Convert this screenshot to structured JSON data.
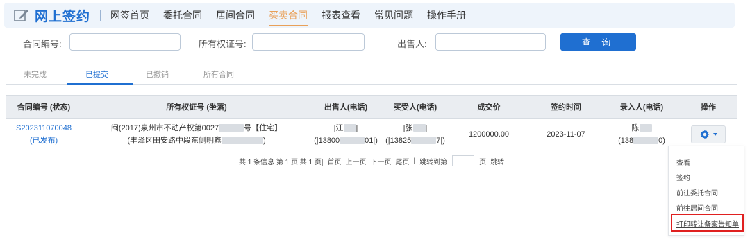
{
  "brand": {
    "title": "网上签约"
  },
  "nav": {
    "items": [
      {
        "label": "网签首页"
      },
      {
        "label": "委托合同"
      },
      {
        "label": "居间合同"
      },
      {
        "label": "买卖合同",
        "active": true
      },
      {
        "label": "报表查看"
      },
      {
        "label": "常见问题"
      },
      {
        "label": "操作手册"
      }
    ]
  },
  "search": {
    "contract_no_label": "合同编号:",
    "contract_no_value": "",
    "ownership_label": "所有权证号:",
    "ownership_value": "",
    "seller_label": "出售人:",
    "seller_value": "",
    "query_button": "查 询"
  },
  "subtabs": [
    {
      "label": "未完成"
    },
    {
      "label": "已提交",
      "active": true
    },
    {
      "label": "已撤销"
    },
    {
      "label": "所有合同"
    }
  ],
  "table": {
    "headers": [
      "合同编号 (状态)",
      "所有权证号 (坐落)",
      "出售人(电话)",
      "买受人(电话)",
      "成交价",
      "签约时间",
      "录入人(电话)",
      "操作"
    ],
    "rows": [
      {
        "contract_no": "S202311070048",
        "status": "(已发布)",
        "cert_line1_a": "闽(2017)泉州市不动产权第0027",
        "cert_line1_b": "号【住宅】",
        "cert_line2_a": "(丰泽区田安路中段东侧明鑫",
        "cert_line2_b": ")",
        "seller_name_a": "|江",
        "seller_name_b": "|",
        "seller_phone_a": "(|13800",
        "seller_phone_b": "01|)",
        "buyer_name_a": "|张",
        "buyer_name_b": "|",
        "buyer_phone_a": "(|13825",
        "buyer_phone_b": "7|)",
        "price": "1200000.00",
        "sign_date": "2023-11-07",
        "entry_name": "陈",
        "entry_phone_a": "(138",
        "entry_phone_b": "0)"
      }
    ]
  },
  "pager": {
    "summary": "共 1 条信息 第 1 页 共 1 页|",
    "first": "首页",
    "prev": "上一页",
    "next": "下一页",
    "last": "尾页",
    "divider": "|",
    "jump_to": "跳转到第",
    "page_unit": "页",
    "jump": "跳转"
  },
  "dropdown": {
    "items": [
      {
        "label": "查看"
      },
      {
        "label": "签约"
      },
      {
        "label": "前往委托合同"
      },
      {
        "label": "前往居间合同"
      },
      {
        "label": "打印转让备案告知单"
      }
    ]
  },
  "colors": {
    "accent": "#1f6fd1",
    "active_nav": "#e9a15a",
    "highlight": "#e02020"
  },
  "icons": {
    "brand": "edit-icon",
    "action": "gear-icon"
  }
}
